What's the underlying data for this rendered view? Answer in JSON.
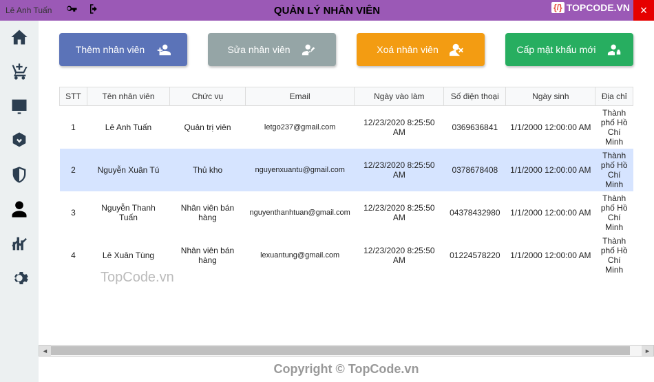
{
  "titlebar": {
    "username": "Lê Anh Tuấn",
    "title": "QUẢN LÝ NHÂN VIÊN",
    "logo_text": "TOPCODE.VN"
  },
  "actions": {
    "add": "Thêm nhân viên",
    "edit": "Sửa nhân viên",
    "delete": "Xoá nhân viên",
    "password": "Cấp mật khẩu mới"
  },
  "table": {
    "headers": {
      "stt": "STT",
      "name": "Tên nhân viên",
      "role": "Chức vụ",
      "email": "Email",
      "join_date": "Ngày vào làm",
      "phone": "Số điện thoại",
      "birth_date": "Ngày sinh",
      "address": "Địa chỉ"
    },
    "rows": [
      {
        "stt": "1",
        "name": "Lê Anh Tuấn",
        "role": "Quản trị viên",
        "email": "letgo237@gmail.com",
        "join_date": "12/23/2020 8:25:50 AM",
        "phone": "0369636841",
        "birth_date": "1/1/2000 12:00:00 AM",
        "address": "Thành phố Hồ Chí Minh",
        "selected": false
      },
      {
        "stt": "2",
        "name": "Nguyễn Xuân Tú",
        "role": "Thủ kho",
        "email": "nguyenxuantu@gmail.com",
        "join_date": "12/23/2020 8:25:50 AM",
        "phone": "0378678408",
        "birth_date": "1/1/2000 12:00:00 AM",
        "address": "Thành phố Hồ Chí Minh",
        "selected": true
      },
      {
        "stt": "3",
        "name": "Nguyễn Thanh Tuấn",
        "role": "Nhân viên bán hàng",
        "email": "nguyenthanhtuan@gmail.com",
        "join_date": "12/23/2020 8:25:50 AM",
        "phone": "04378432980",
        "birth_date": "1/1/2000 12:00:00 AM",
        "address": "Thành phố Hồ Chí Minh",
        "selected": false
      },
      {
        "stt": "4",
        "name": "Lê Xuân Tùng",
        "role": "Nhân viên bán hàng",
        "email": "lexuantung@gmail.com",
        "join_date": "12/23/2020 8:25:50 AM",
        "phone": "01224578220",
        "birth_date": "1/1/2000 12:00:00 AM",
        "address": "Thành phố Hồ Chí Minh",
        "selected": false
      }
    ]
  },
  "watermark": "TopCode.vn",
  "copyright": "Copyright © TopCode.vn"
}
